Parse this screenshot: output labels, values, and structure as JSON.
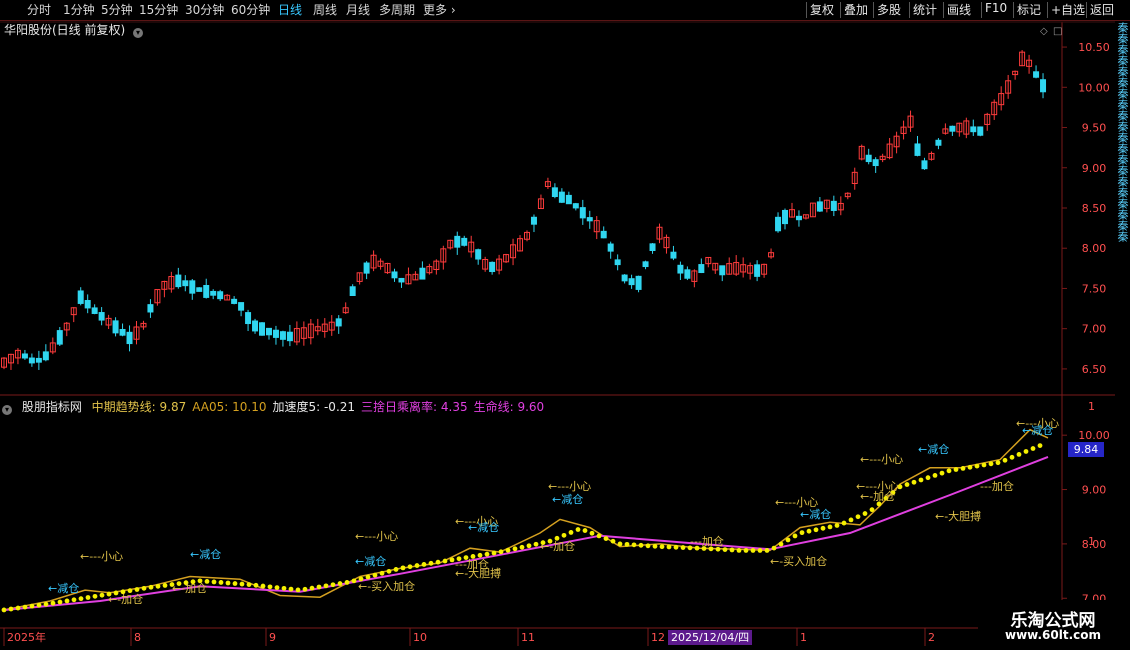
{
  "toolbar": {
    "periods": [
      {
        "label": "分时",
        "active": false
      },
      {
        "label": "1分钟",
        "active": false
      },
      {
        "label": "5分钟",
        "active": false
      },
      {
        "label": "15分钟",
        "active": false
      },
      {
        "label": "30分钟",
        "active": false
      },
      {
        "label": "60分钟",
        "active": false
      },
      {
        "label": "日线",
        "active": true
      },
      {
        "label": "周线",
        "active": false
      },
      {
        "label": "月线",
        "active": false
      },
      {
        "label": "多周期",
        "active": false
      },
      {
        "label": "更多",
        "active": false
      }
    ],
    "actions": [
      "复权",
      "叠加",
      "多股",
      "统计",
      "画线",
      "F10",
      "标记",
      "+自选",
      "返回"
    ]
  },
  "chart_title": "华阳股份(日线 前复权)",
  "price_axis": [
    "10.50",
    "10.00",
    "9.50",
    "9.00",
    "8.50",
    "8.00",
    "7.50",
    "7.00",
    "6.50"
  ],
  "indicator": {
    "name": "股朋指标网",
    "fields": [
      {
        "label": "中期趋势线:",
        "value": "9.87",
        "color": "#e0c24a"
      },
      {
        "label": "AA05:",
        "value": "10.10",
        "color": "#d4a020"
      },
      {
        "label": "加速度5:",
        "value": "-0.21",
        "color": "#e8e8e8"
      },
      {
        "label": "三捨日乘离率:",
        "value": "4.35",
        "color": "#e040e0"
      },
      {
        "label": "生命线:",
        "value": "9.60",
        "color": "#e040e0"
      }
    ],
    "axis": [
      "10.00",
      "9.00",
      "8.00",
      "7.00"
    ],
    "current_tag": "9.84",
    "signals": {
      "cang_xiao": "←---小心",
      "jian_cang": "←减仓",
      "jia_cang": "←-加仓",
      "jia_cang2": "---加仓",
      "mai_ru": "←-买入加仓",
      "da_dan": "←-大胆搏",
      "jian_cang2": "←减仓"
    }
  },
  "time_axis": {
    "labels": [
      "2025年",
      "8",
      "9",
      "10",
      "11",
      "12",
      "1",
      "2"
    ],
    "highlight": "2025/12/04/四"
  },
  "right_strip": "秦秦秦秦秦秦秦秦秦秦秦秦秦秦秦秦秦秦秦秦",
  "watermark": {
    "line1": "乐淘公式网",
    "line2": "www.60lt.com"
  },
  "colors": {
    "up": "#ff3c3c",
    "down": "#30d6f0",
    "grid": "#7a1a1a",
    "trend": "#d4a020",
    "life": "#e040e0",
    "dots": "#f5f000"
  },
  "chart_data": {
    "type": "candlestick",
    "y_range": [
      6.3,
      10.65
    ],
    "candles": [],
    "note": ""
  }
}
